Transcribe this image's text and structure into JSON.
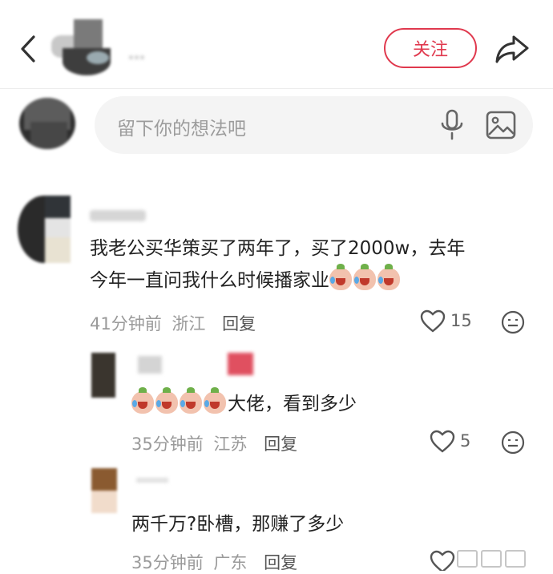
{
  "header": {
    "follow_label": "关注",
    "username": "...",
    "back_icon": "chevron-left-icon",
    "share_icon": "share-arrow-icon"
  },
  "composer": {
    "placeholder": "留下你的想法吧",
    "mic_icon": "microphone-icon",
    "image_icon": "image-icon"
  },
  "comments": [
    {
      "text_line1": "我老公买华策买了两年了，买了2000w，去年",
      "text_line2": "今年一直问我什么时候播家业",
      "time": "41分钟前",
      "location": "浙江",
      "reply_label": "回复",
      "likes": "15"
    },
    {
      "text": "大佬，看到多少",
      "time": "35分钟前",
      "location": "江苏",
      "reply_label": "回复",
      "likes": "5"
    },
    {
      "text": "两千万?卧槽，那赚了多少",
      "time": "35分钟前",
      "location": "广东",
      "reply_label": "回复"
    }
  ],
  "colors": {
    "accent": "#e0394e",
    "meta": "#9a9a9a",
    "composer_bg": "#f4f4f4"
  }
}
